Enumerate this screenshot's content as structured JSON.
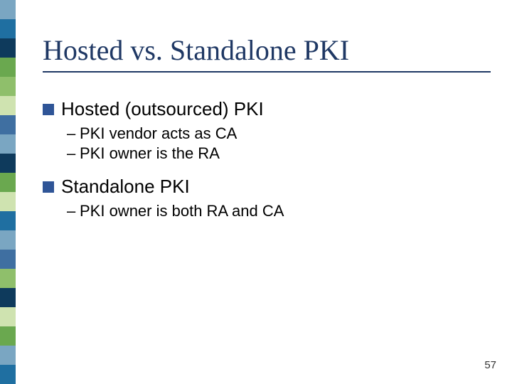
{
  "accent_color": "#1f3864",
  "title": "Hosted vs. Standalone PKI",
  "sections": [
    {
      "heading": "Hosted (outsourced) PKI",
      "subpoints": [
        "PKI vendor acts as CA",
        "PKI owner is the RA"
      ]
    },
    {
      "heading": "Standalone PKI",
      "subpoints": [
        "PKI owner is both RA and CA"
      ]
    }
  ],
  "page_number": "57",
  "sidebar_colors": [
    "#7aa6c2",
    "#1f6fa1",
    "#0e3a5c",
    "#6aa84f",
    "#8fbf6b",
    "#cfe3b0",
    "#3f6fa1",
    "#7aa6c2",
    "#0e3a5c",
    "#6aa84f",
    "#cfe3b0",
    "#1f6fa1",
    "#7aa6c2",
    "#3f6fa1",
    "#8fbf6b",
    "#0e3a5c",
    "#cfe3b0",
    "#6aa84f",
    "#7aa6c2",
    "#1f6fa1"
  ]
}
